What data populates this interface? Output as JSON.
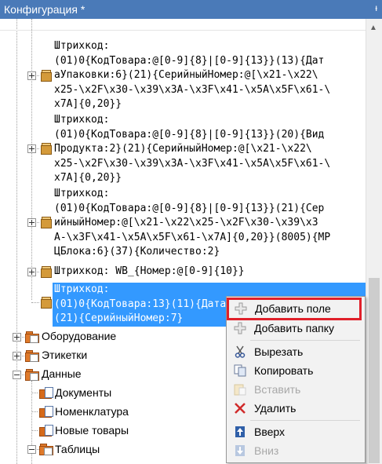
{
  "window": {
    "title": "Конфигурация *",
    "pin_glyph": "ᵼ"
  },
  "tree": {
    "barcode_items": [
      {
        "text": "Штрихкод:\n(01)0{КодТовара:@[0-9]{8}|[0-9]{13}}(13){Дат\nаУпаковки:6}(21){СерийныйНомер:@[\\x21-\\x22\\\nx25-\\x2F\\x30-\\x39\\x3A-\\x3F\\x41-\\x5A\\x5F\\x61-\\\nx7A]{0,20}}"
      },
      {
        "text": "Штрихкод:\n(01)0{КодТовара:@[0-9]{8}|[0-9]{13}}(20){Вид\nПродукта:2}(21){СерийныйНомер:@[\\x21-\\x22\\\nx25-\\x2F\\x30-\\x39\\x3A-\\x3F\\x41-\\x5A\\x5F\\x61-\\\nx7A]{0,20}}"
      },
      {
        "text": "Штрихкод:\n(01)0{КодТовара:@[0-9]{8}|[0-9]{13}}(21){Сер\nийныйНомер:@[\\x21-\\x22\\x25-\\x2F\\x30-\\x39\\x3\nA-\\x3F\\x41-\\x5A\\x5F\\x61-\\x7A]{0,20}}(8005){МР\nЦБлока:6}(37){Количество:2}"
      },
      {
        "text": "Штрихкод: WB_{Номер:@[0-9]{10}}"
      },
      {
        "text": "Штрихкод:\n(01)0{КодТовара:13}(11){Дата\n(21){СерийныйНомер:7}"
      }
    ],
    "nodes": {
      "equipment": "Оборудование",
      "labels": "Этикетки",
      "data": "Данные",
      "documents": "Документы",
      "nomenclature": "Номенклатура",
      "new_goods": "Новые товары",
      "tables": "Таблицы"
    }
  },
  "context_menu": {
    "add_field": "Добавить поле",
    "add_folder": "Добавить папку",
    "cut": "Вырезать",
    "copy": "Копировать",
    "paste": "Вставить",
    "delete": "Удалить",
    "up": "Вверх",
    "down": "Вниз"
  }
}
